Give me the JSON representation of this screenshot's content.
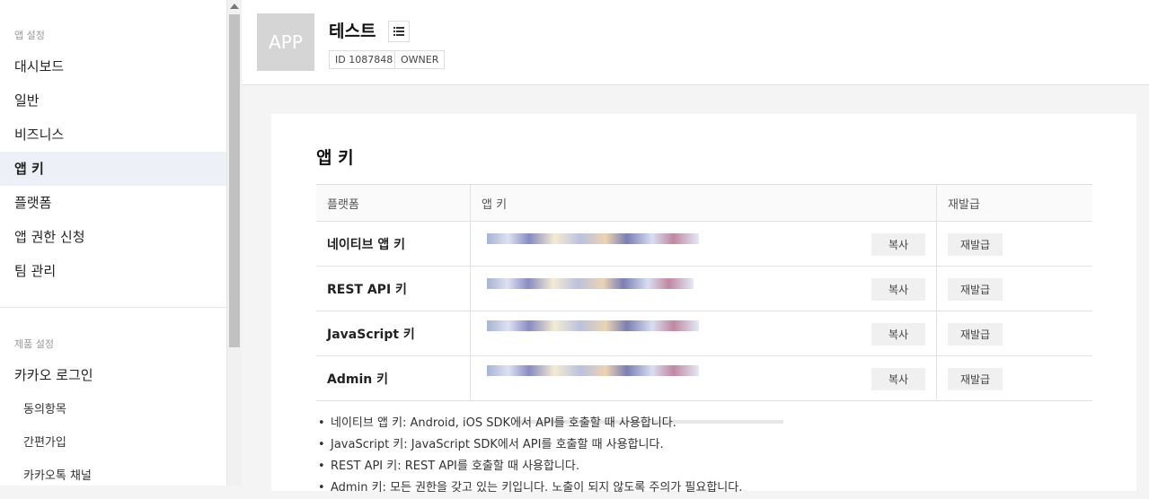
{
  "sidebar": {
    "section1": "앱 설정",
    "items": [
      {
        "label": "대시보드"
      },
      {
        "label": "일반"
      },
      {
        "label": "비즈니스"
      },
      {
        "label": "앱 키"
      },
      {
        "label": "플랫폼"
      },
      {
        "label": "앱 권한 신청"
      },
      {
        "label": "팀 관리"
      }
    ],
    "active_index": 3,
    "section2": "제품 설정",
    "product_item": "카카오 로그인",
    "sub_items": [
      {
        "label": "동의항목"
      },
      {
        "label": "간편가입"
      },
      {
        "label": "카카오톡 채널"
      }
    ]
  },
  "header": {
    "thumb": "APP",
    "app_name": "테스트",
    "badge_id": "ID 1087848",
    "badge_role": "OWNER",
    "list_icon": "list-icon"
  },
  "card": {
    "title": "앱 키",
    "columns": [
      "플랫폼",
      "앱 키",
      "재발급"
    ],
    "rows": [
      {
        "platform": "네이티브 앱 키",
        "copy": "복사",
        "reissue": "재발급"
      },
      {
        "platform": "REST API 키",
        "copy": "복사",
        "reissue": "재발급"
      },
      {
        "platform": "JavaScript 키",
        "copy": "복사",
        "reissue": "재발급"
      },
      {
        "platform": "Admin 키",
        "copy": "복사",
        "reissue": "재발급"
      }
    ],
    "notes": [
      "네이티브 앱 키: Android, iOS SDK에서 API를 호출할 때 사용합니다.",
      "JavaScript 키: JavaScript SDK에서 API를 호출할 때 사용합니다.",
      "REST API 키: REST API를 호출할 때 사용합니다.",
      "Admin 키: 모든 권한을 갖고 있는 키입니다. 노출이 되지 않도록 주의가 필요합니다."
    ]
  }
}
